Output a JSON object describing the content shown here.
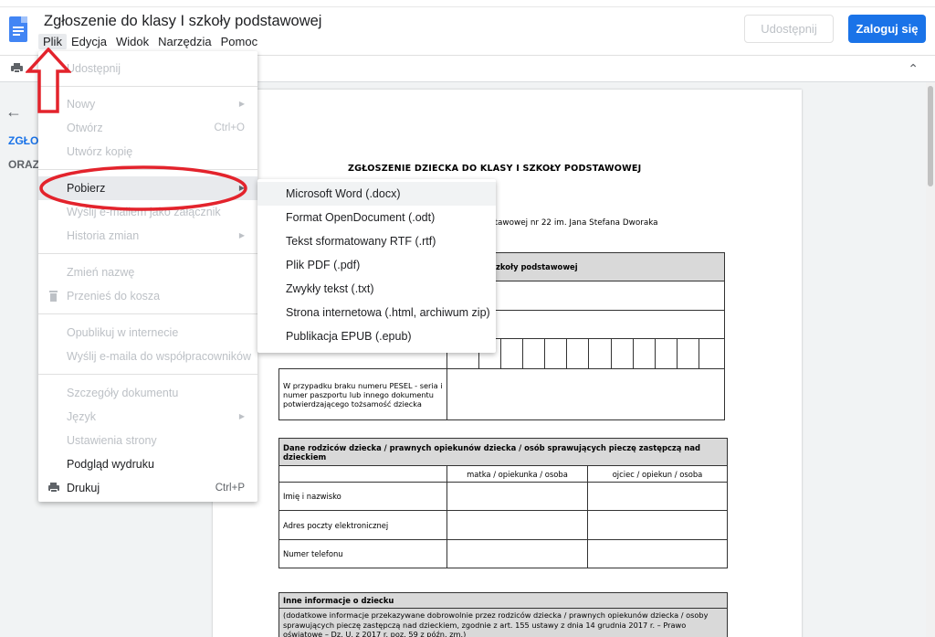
{
  "window": {
    "doc_title": "Zgłoszenie do klasy I szkoły podstawowej"
  },
  "menubar": [
    "Plik",
    "Edycja",
    "Widok",
    "Narzędzia",
    "Pomoc"
  ],
  "header": {
    "share_label": "Udostępnij",
    "login_label": "Zaloguj się"
  },
  "outline": {
    "item1": "ZGŁO",
    "item2": "ORAZ"
  },
  "file_menu": {
    "items": [
      {
        "label": "Udostępnij",
        "enabled": false
      },
      {
        "label": "Nowy",
        "enabled": false,
        "submenu": true
      },
      {
        "label": "Otwórz",
        "enabled": false,
        "shortcut": "Ctrl+O"
      },
      {
        "label": "Utwórz kopię",
        "enabled": false
      },
      {
        "label": "Pobierz",
        "enabled": true,
        "submenu": true,
        "highlighted": true
      },
      {
        "label": "Wyślij e-mailem jako załącznik",
        "enabled": false
      },
      {
        "label": "Historia zmian",
        "enabled": false,
        "submenu": true
      },
      {
        "label": "Zmień nazwę",
        "enabled": false
      },
      {
        "label": "Przenieś do kosza",
        "enabled": false,
        "icon": "trash-icon"
      },
      {
        "label": "Opublikuj w internecie",
        "enabled": false
      },
      {
        "label": "Wyślij e-maila do współpracowników",
        "enabled": false
      },
      {
        "label": "Szczegóły dokumentu",
        "enabled": false
      },
      {
        "label": "Język",
        "enabled": false,
        "submenu": true
      },
      {
        "label": "Ustawienia strony",
        "enabled": false
      },
      {
        "label": "Podgląd wydruku",
        "enabled": true
      },
      {
        "label": "Drukuj",
        "enabled": true,
        "shortcut": "Ctrl+P",
        "icon": "print-icon"
      }
    ]
  },
  "download_submenu": {
    "items": [
      "Microsoft Word (.docx)",
      "Format OpenDocument (.odt)",
      "Tekst sformatowany RTF (.rtf)",
      "Plik PDF (.pdf)",
      "Zwykły tekst (.txt)",
      "Strona internetowa (.html, archiwum zip)",
      "Publikacja EPUB (.epub)"
    ]
  },
  "document": {
    "title": "ZGŁOSZENIE DZIECKA DO KLASY I SZKOŁY PODSTAWOWEJ",
    "school_line": "stawowej nr 22 im. Jana Stefana Dworaka",
    "table1": {
      "header_fragment": "szkoły podstawowej",
      "pesel_note": "W przypadku braku numeru PESEL - seria i numer paszportu lub innego dokumentu potwierdzającego tożsamość dziecka"
    },
    "table2": {
      "header": "Dane rodziców dziecka / prawnych opiekunów dziecka / osób sprawujących pieczę zastępczą nad dzieckiem",
      "col_mother": "matka / opiekunka / osoba",
      "col_father": "ojciec / opiekun / osoba",
      "rows": [
        "Imię i nazwisko",
        "Adres poczty elektronicznej",
        "Numer telefonu"
      ]
    },
    "table3": {
      "header": "Inne informacje o dziecku",
      "note": "(dodatkowe informacje przekazywane dobrowolnie przez rodziców dziecka / prawnych opiekunów dziecka / osoby sprawujących pieczę zastępczą nad dzieckiem, zgodnie z art. 155 ustawy z dnia 14 grudnia 2017 r. – Prawo oświatowe – Dz. U. z 2017 r. poz. 59 z późn. zm.)"
    }
  },
  "colors": {
    "accent": "#1a73e8",
    "annotation": "#e3232c"
  }
}
